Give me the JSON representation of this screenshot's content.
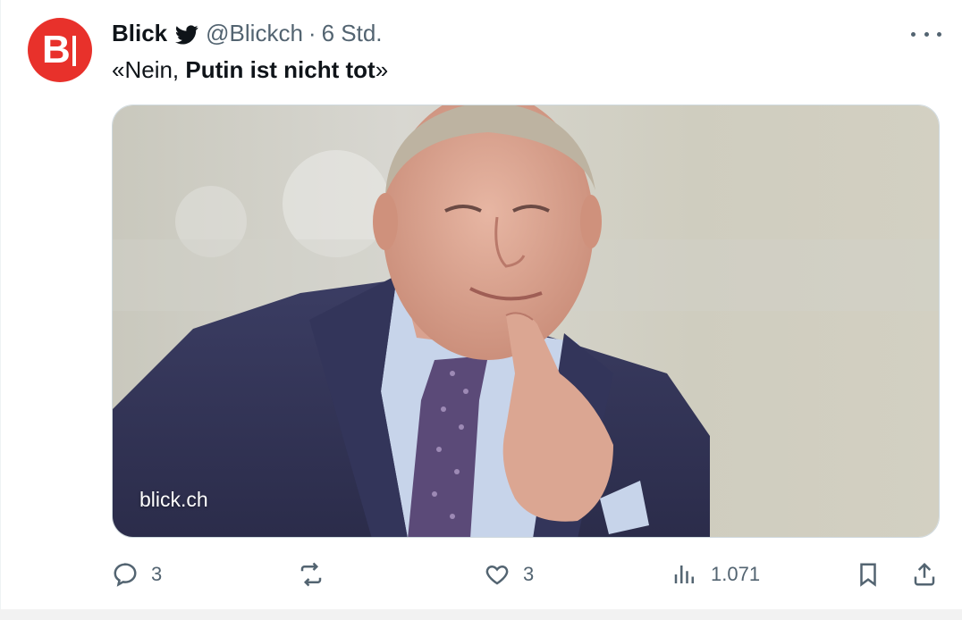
{
  "tweet": {
    "author_name": "Blick",
    "handle": "@Blickch",
    "separator": "·",
    "time": "6 Std.",
    "text_prefix": "«Nein, ",
    "text_bold": "Putin ist nicht tot",
    "text_suffix": "»",
    "avatar_letter": "B",
    "avatar_color": "#e8312b",
    "media_watermark": "blick.ch"
  },
  "actions": {
    "replies": "3",
    "retweets": "",
    "likes": "3",
    "views": "1.071"
  },
  "icons": [
    "twitter-bird-icon",
    "more-options-icon",
    "reply-icon",
    "retweet-icon",
    "like-icon",
    "views-icon",
    "bookmark-icon",
    "share-icon"
  ],
  "colors": {
    "text": "#0f1419",
    "secondary": "#536471",
    "brand": "#e8312b"
  }
}
